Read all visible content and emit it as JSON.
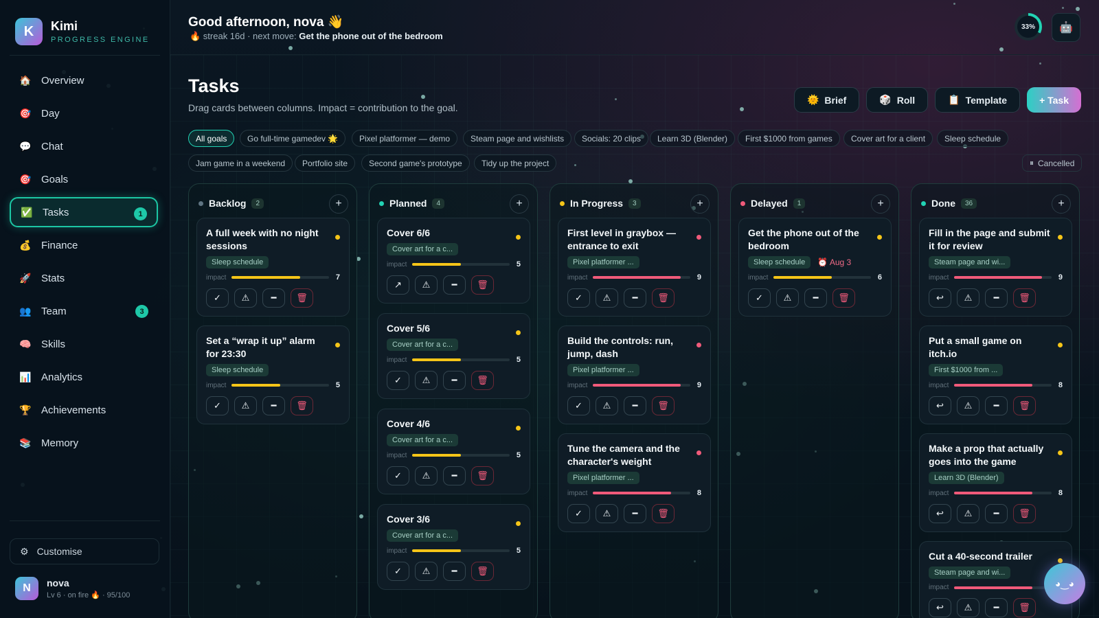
{
  "brand": {
    "name": "Kimi",
    "sub": "PROGRESS ENGINE",
    "logo": "K"
  },
  "nav": [
    {
      "label": "Overview",
      "icon": "🏠"
    },
    {
      "label": "Day",
      "icon": "🎯"
    },
    {
      "label": "Chat",
      "icon": "💬"
    },
    {
      "label": "Goals",
      "icon": "🎯"
    },
    {
      "label": "Tasks",
      "icon": "✅",
      "badge": "1",
      "active": true
    },
    {
      "label": "Finance",
      "icon": "💰"
    },
    {
      "label": "Stats",
      "icon": "🚀"
    },
    {
      "label": "Team",
      "icon": "👥",
      "badge": "3"
    },
    {
      "label": "Skills",
      "icon": "🧠"
    },
    {
      "label": "Analytics",
      "icon": "📊"
    },
    {
      "label": "Achievements",
      "icon": "🏆"
    },
    {
      "label": "Memory",
      "icon": "📚"
    }
  ],
  "customise": {
    "label": "Customise",
    "icon": "⚙"
  },
  "user": {
    "initial": "N",
    "name": "nova",
    "status": "Lv 6 · on fire 🔥 · 95/100"
  },
  "top": {
    "greeting": "Good afternoon, nova 👋",
    "streak_prefix": "🔥 streak 16d · next move: ",
    "next_move": "Get the phone out of the bedroom",
    "progress": "33%",
    "progress_value": 0.33,
    "robot_icon": "🤖"
  },
  "header": {
    "title": "Tasks",
    "subtitle": "Drag cards between columns. Impact = contribution to the goal.",
    "buttons": [
      {
        "icon": "🌞",
        "label": "Brief"
      },
      {
        "icon": "🎲",
        "label": "Roll"
      },
      {
        "icon": "📋",
        "label": "Template"
      },
      {
        "icon": "",
        "label": "+ Task"
      }
    ]
  },
  "filters": [
    "All goals",
    "Go full-time gamedev 🌟",
    "Pixel platformer — demo",
    "Steam page and wishlists",
    "Socials: 20 clips",
    "Learn 3D (Blender)",
    "First $1000 from games",
    "Cover art for a client",
    "Sleep schedule",
    "Jam game in a weekend",
    "Portfolio site",
    "Second game's prototype",
    "Tidy up the project"
  ],
  "cancelled": "Cancelled",
  "impact_label": "impact",
  "colors": {
    "yellow": "#f5c518",
    "red": "#f05a7a",
    "teal": "#22d3b4",
    "grey": "#5f7482"
  },
  "columns": [
    {
      "title": "Backlog",
      "count": "2",
      "dot": "#5f7482",
      "cards": [
        {
          "title": "A full week with no night sessions",
          "tag": "Sleep schedule",
          "impact": 7,
          "pri": "#f5c518",
          "color": "#f5c518",
          "acts": [
            "✓",
            "⚠",
            "━",
            "🗑"
          ]
        },
        {
          "title": "Set a “wrap it up” alarm for 23:30",
          "tag": "Sleep schedule",
          "impact": 5,
          "pri": "#f5c518",
          "color": "#f5c518",
          "acts": [
            "✓",
            "⚠",
            "━",
            "🗑"
          ]
        }
      ]
    },
    {
      "title": "Planned",
      "count": "4",
      "dot": "#22d3b4",
      "cards": [
        {
          "title": "Cover 6/6",
          "tag": "Cover art for a c...",
          "impact": 5,
          "pri": "#f5c518",
          "color": "#f5c518",
          "acts": [
            "↗",
            "⚠",
            "━",
            "🗑"
          ]
        },
        {
          "title": "Cover 5/6",
          "tag": "Cover art for a c...",
          "impact": 5,
          "pri": "#f5c518",
          "color": "#f5c518",
          "acts": [
            "✓",
            "⚠",
            "━",
            "🗑"
          ]
        },
        {
          "title": "Cover 4/6",
          "tag": "Cover art for a c...",
          "impact": 5,
          "pri": "#f5c518",
          "color": "#f5c518",
          "acts": [
            "✓",
            "⚠",
            "━",
            "🗑"
          ]
        },
        {
          "title": "Cover 3/6",
          "tag": "Cover art for a c...",
          "impact": 5,
          "pri": "#f5c518",
          "color": "#f5c518",
          "acts": [
            "✓",
            "⚠",
            "━",
            "🗑"
          ]
        }
      ]
    },
    {
      "title": "In Progress",
      "count": "3",
      "dot": "#f5c518",
      "cards": [
        {
          "title": "First level in graybox — entrance to exit",
          "tag": "Pixel platformer ...",
          "impact": 9,
          "pri": "#f05a7a",
          "color": "#f05a7a",
          "acts": [
            "✓",
            "⚠",
            "━",
            "🗑"
          ]
        },
        {
          "title": "Build the controls: run, jump, dash",
          "tag": "Pixel platformer ...",
          "impact": 9,
          "pri": "#f05a7a",
          "color": "#f05a7a",
          "acts": [
            "✓",
            "⚠",
            "━",
            "🗑"
          ]
        },
        {
          "title": "Tune the camera and the character's weight",
          "tag": "Pixel platformer ...",
          "impact": 8,
          "pri": "#f05a7a",
          "color": "#f05a7a",
          "acts": [
            "✓",
            "⚠",
            "━",
            "🗑"
          ]
        }
      ]
    },
    {
      "title": "Delayed",
      "count": "1",
      "dot": "#f05a7a",
      "cards": [
        {
          "title": "Get the phone out of the bedroom",
          "tag": "Sleep schedule",
          "due": "⏰ Aug 3",
          "impact": 6,
          "pri": "#f5c518",
          "color": "#f5c518",
          "acts": [
            "✓",
            "⚠",
            "━",
            "🗑"
          ]
        }
      ]
    },
    {
      "title": "Done",
      "count": "36",
      "dot": "#22d3b4",
      "cards": [
        {
          "title": "Fill in the page and submit it for review",
          "tag": "Steam page and wi...",
          "impact": 9,
          "pri": "#f5c518",
          "color": "#f05a7a",
          "acts": [
            "↩",
            "⚠",
            "━",
            "🗑"
          ]
        },
        {
          "title": "Put a small game on itch.io",
          "tag": "First $1000 from ...",
          "impact": 8,
          "pri": "#f5c518",
          "color": "#f05a7a",
          "acts": [
            "↩",
            "⚠",
            "━",
            "🗑"
          ]
        },
        {
          "title": "Make a prop that actually goes into the game",
          "tag": "Learn 3D (Blender)",
          "impact": 8,
          "pri": "#f5c518",
          "color": "#f05a7a",
          "acts": [
            "↩",
            "⚠",
            "━",
            "🗑"
          ]
        },
        {
          "title": "Cut a 40-second trailer",
          "tag": "Steam page and wi...",
          "impact": "",
          "pri": "#f5c518",
          "color": "#f05a7a",
          "fill": 0.8,
          "acts": [
            "↩",
            "⚠",
            "━",
            "🗑"
          ]
        }
      ]
    }
  ],
  "assistant_icon": "◕‿◕"
}
